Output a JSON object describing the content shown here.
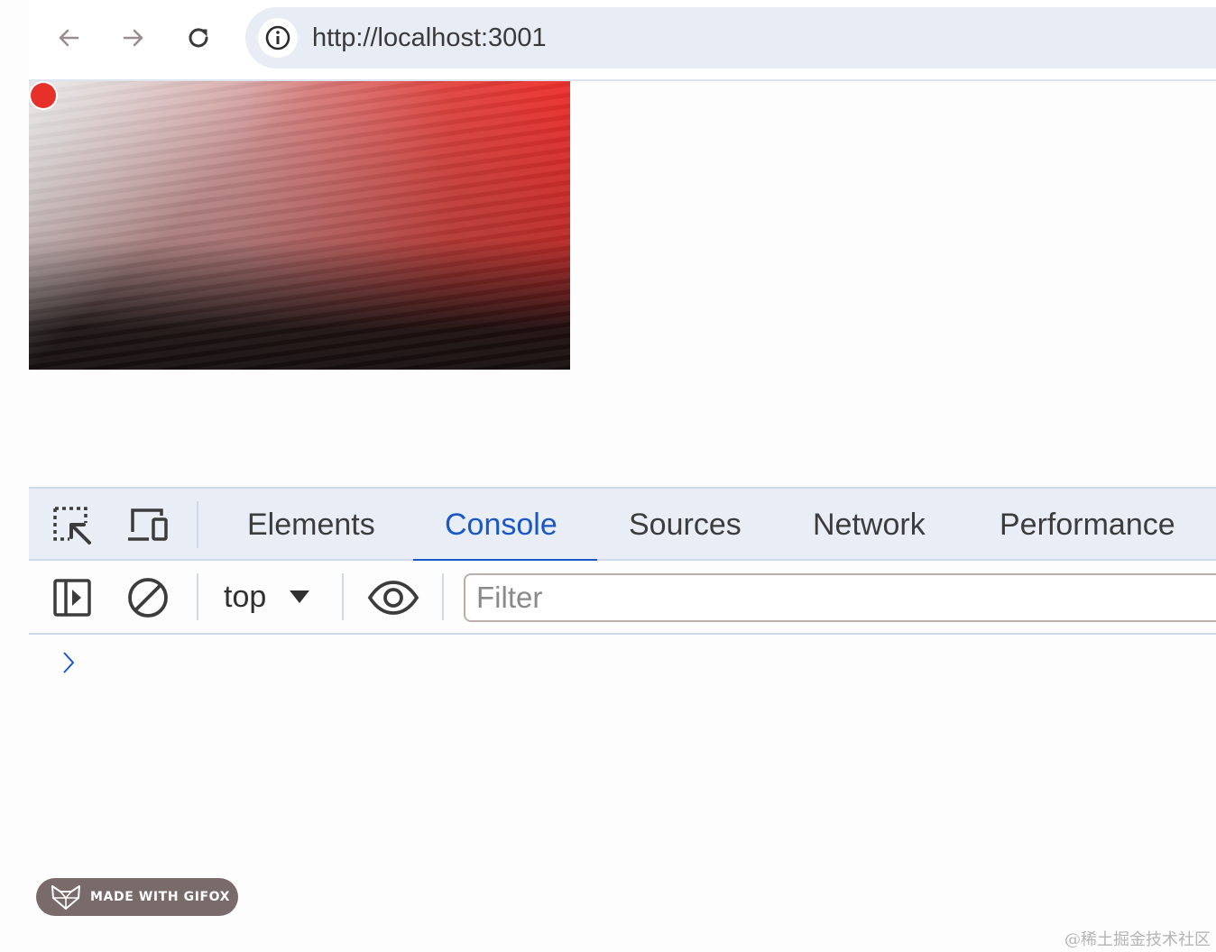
{
  "browser": {
    "url": "http://localhost:3001",
    "icons": {
      "back": "arrow-left-icon",
      "forward": "arrow-right-icon",
      "reload": "reload-icon",
      "site_info": "info-icon"
    }
  },
  "page": {
    "canvas_colors": [
      "#ee2f2c",
      "#cfcfcf",
      "#171010"
    ],
    "dot_color": "#e8302b"
  },
  "devtools": {
    "tabs": [
      {
        "label": "Elements",
        "active": false
      },
      {
        "label": "Console",
        "active": true
      },
      {
        "label": "Sources",
        "active": false
      },
      {
        "label": "Network",
        "active": false
      },
      {
        "label": "Performance",
        "active": false
      }
    ],
    "accent_color": "#1a57c7",
    "toolbar": {
      "context": "top",
      "filter_placeholder": "Filter"
    },
    "icons": {
      "inspect": "inspect-element-icon",
      "device": "device-toolbar-icon",
      "sidebar": "sidebar-toggle-icon",
      "clear": "clear-console-icon",
      "live_expression": "eye-icon",
      "prompt": "chevron-right-icon"
    }
  },
  "overlay": {
    "gifox_label": "MADE WITH GIFOX",
    "watermark": "@稀土掘金技术社区"
  }
}
